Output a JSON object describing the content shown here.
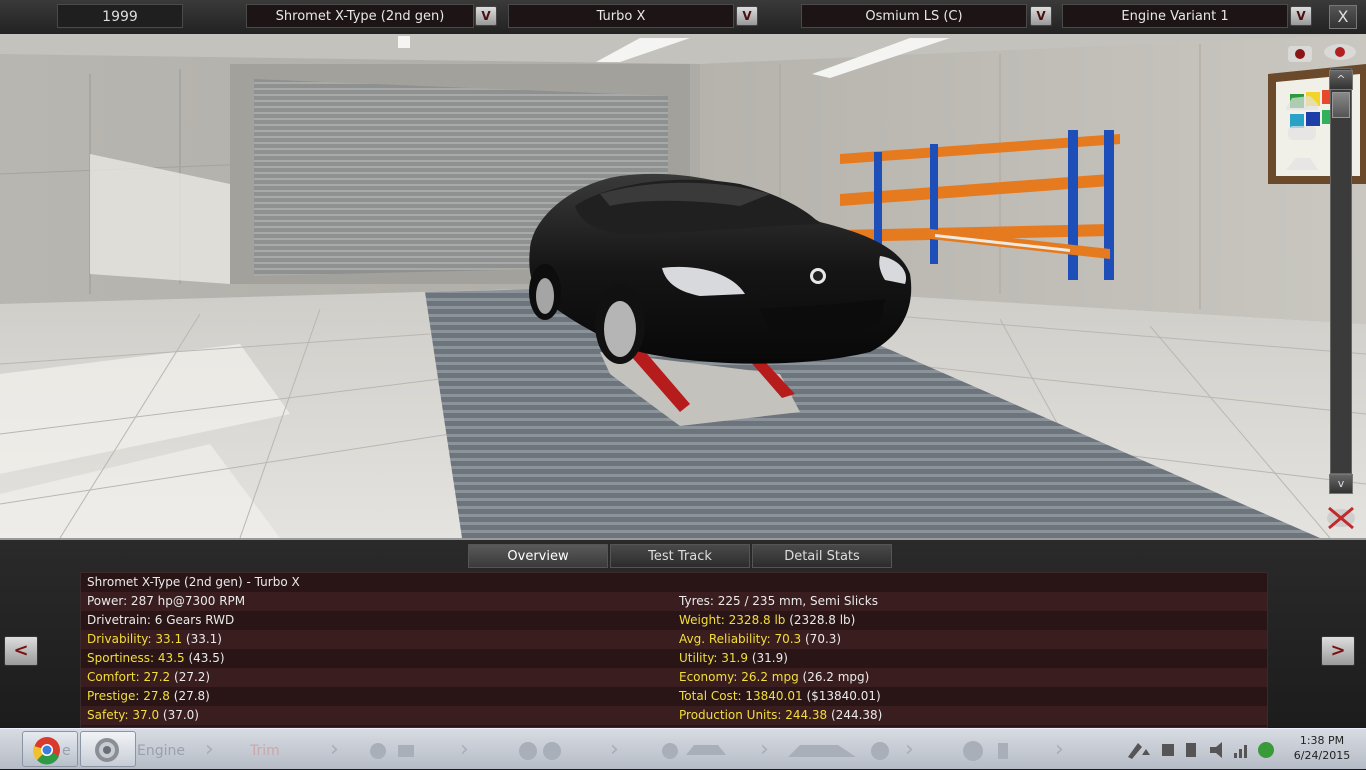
{
  "topbar": {
    "year": "1999",
    "model": "Shromet X-Type (2nd gen)",
    "trim": "Turbo X",
    "engine_family": "Osmium LS (C)",
    "engine_variant": "Engine Variant 1",
    "dropdown_glyph": "V",
    "close_glyph": "X"
  },
  "scene": {
    "scroll_up": "^",
    "scroll_down": "v"
  },
  "panel": {
    "tabs": [
      "Overview",
      "Test Track",
      "Detail Stats"
    ],
    "active_tab": "Overview",
    "prev_glyph": "<",
    "next_glyph": ">",
    "title": "Shromet X-Type (2nd gen) - Turbo X",
    "left": [
      {
        "label": "Power: 287 hp@7300 RPM",
        "extra": "",
        "highlight": false
      },
      {
        "label": "Drivetrain: 6 Gears RWD",
        "extra": "",
        "highlight": false
      },
      {
        "label": "Drivability: 33.1",
        "extra": " (33.1)",
        "highlight": true
      },
      {
        "label": "Sportiness: 43.5",
        "extra": " (43.5)",
        "highlight": true
      },
      {
        "label": "Comfort: 27.2",
        "extra": " (27.2)",
        "highlight": true
      },
      {
        "label": "Prestige: 27.8",
        "extra": " (27.8)",
        "highlight": true
      },
      {
        "label": "Safety: 37.0",
        "extra": " (37.0)",
        "highlight": true
      }
    ],
    "right": [
      {
        "label": "Tyres: 225 / 235 mm, Semi Slicks",
        "extra": "",
        "highlight": false
      },
      {
        "label": "Weight: 2328.8 lb",
        "extra": " (2328.8 lb)",
        "highlight": true
      },
      {
        "label": "Avg. Reliability: 70.3",
        "extra": " (70.3)",
        "highlight": true
      },
      {
        "label": "Utility: 31.9",
        "extra": " (31.9)",
        "highlight": true
      },
      {
        "label": "Economy: 26.2 mpg",
        "extra": " (26.2 mpg)",
        "highlight": true
      },
      {
        "label": "Total Cost: 13840.01",
        "extra": " ($13840.01)",
        "highlight": true
      },
      {
        "label": "Production Units: 244.38",
        "extra": " (244.38)",
        "highlight": true
      }
    ]
  },
  "taskbar": {
    "ghost_engine": "Engine",
    "ghost_trim": "Trim",
    "ghost_prefix": "e",
    "time": "1:38 PM",
    "date": "6/24/2015"
  },
  "colors": {
    "highlight": "#f2df3a",
    "panel_bg": "#2a1516",
    "panel_alt": "#3a1d1f"
  }
}
